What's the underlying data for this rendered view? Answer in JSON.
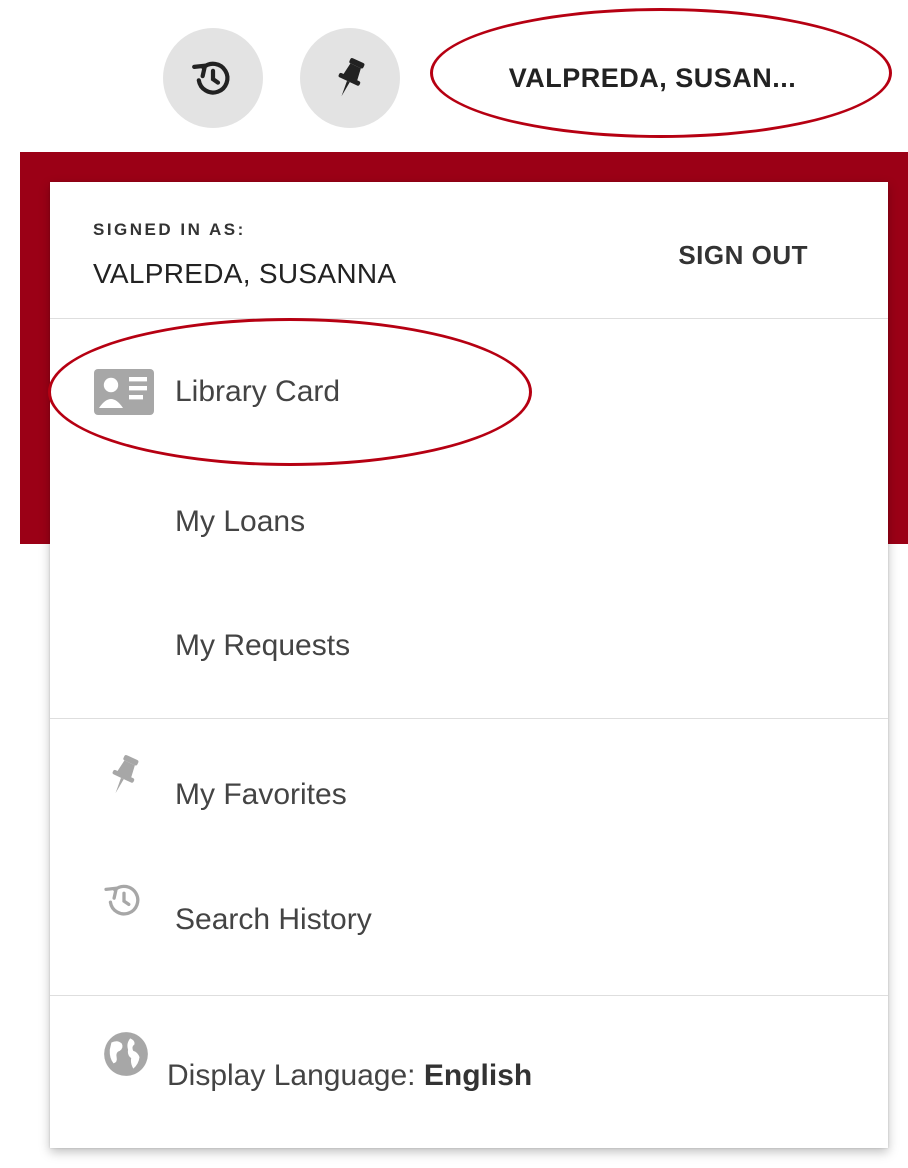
{
  "header": {
    "history_button": {
      "icon": "history-icon"
    },
    "pin_button": {
      "icon": "pin-icon"
    },
    "user_button_label": "VALPREDA, SUSAN..."
  },
  "menu": {
    "signed_in_label": "SIGNED IN AS:",
    "user_name": "VALPREDA, SUSANNA",
    "sign_out_label": "SIGN OUT",
    "items": [
      {
        "label": "Library Card",
        "icon": "id-card-icon"
      },
      {
        "label": "My Loans"
      },
      {
        "label": "My Requests"
      },
      {
        "label": "My Favorites",
        "icon": "pin-icon"
      },
      {
        "label": "Search History",
        "icon": "history-icon"
      }
    ],
    "language": {
      "prefix": "Display Language: ",
      "value": "English",
      "icon": "globe-icon"
    }
  },
  "colors": {
    "brand_red": "#9b0016",
    "annotation_red": "#b60012",
    "icon_button_bg": "#e3e3e3",
    "menu_icon_gray": "#a7a7a7"
  }
}
